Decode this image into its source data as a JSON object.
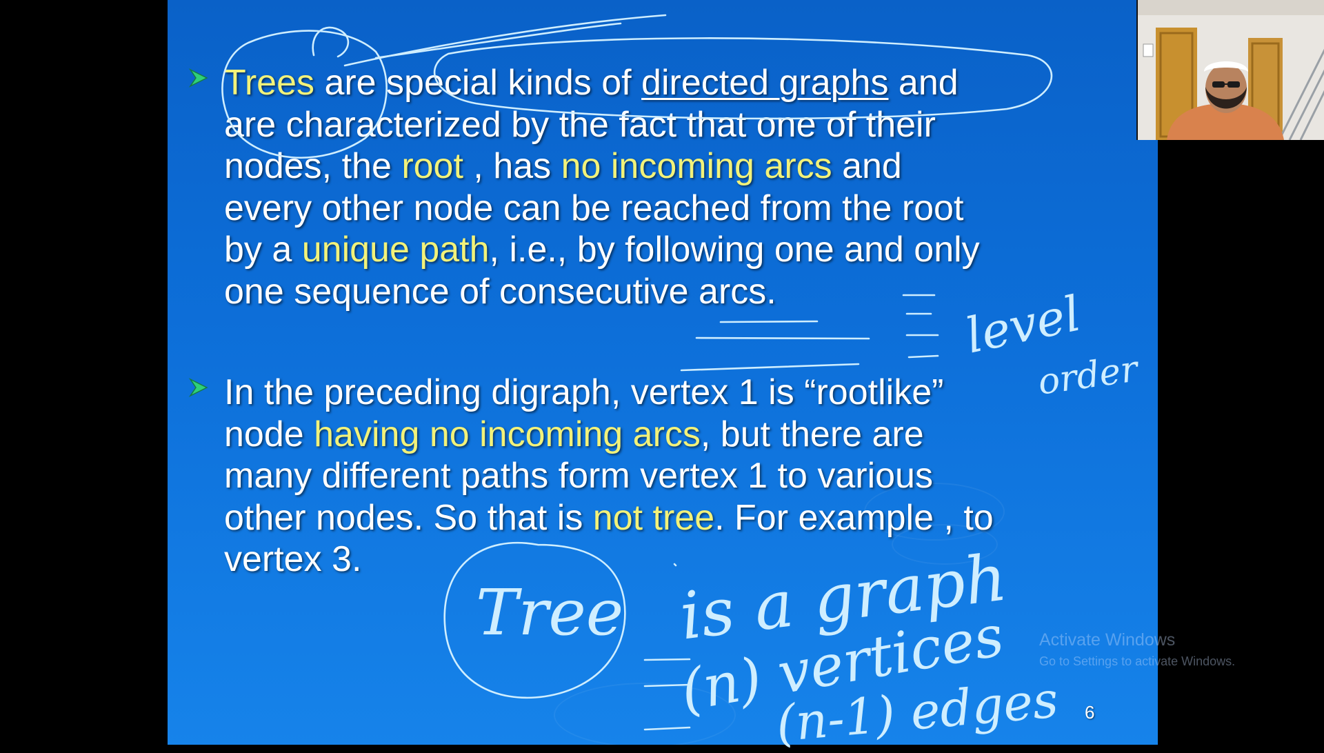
{
  "slide": {
    "page_number": "6",
    "bullets": [
      {
        "lines": [
          [
            {
              "text": "Trees",
              "style": "hl"
            },
            {
              "text": " are special kinds of ",
              "style": ""
            },
            {
              "text": "directed graphs",
              "style": "ul"
            },
            {
              "text": " and",
              "style": ""
            }
          ],
          [
            {
              "text": "are characterized by the fact that one of their",
              "style": ""
            }
          ],
          [
            {
              "text": "nodes, the ",
              "style": ""
            },
            {
              "text": "root",
              "style": "hl"
            },
            {
              "text": " , has ",
              "style": ""
            },
            {
              "text": "no incoming  arcs",
              "style": "hl"
            },
            {
              "text": " and",
              "style": ""
            }
          ],
          [
            {
              "text": "every other node can be reached from the root",
              "style": ""
            }
          ],
          [
            {
              "text": "by a ",
              "style": ""
            },
            {
              "text": "unique path",
              "style": "hl"
            },
            {
              "text": ", i.e., by following one and only",
              "style": ""
            }
          ],
          [
            {
              "text": "one sequence of consecutive arcs.",
              "style": ""
            }
          ]
        ]
      },
      {
        "lines": [
          [
            {
              "text": "In the preceding digraph, vertex 1 is “rootlike”",
              "style": ""
            }
          ],
          [
            {
              "text": "node  ",
              "style": ""
            },
            {
              "text": "having no incoming arcs",
              "style": "hl"
            },
            {
              "text": ", but there are",
              "style": ""
            }
          ],
          [
            {
              "text": "many different paths form vertex 1 to various",
              "style": ""
            }
          ],
          [
            {
              "text": "other nodes. So that is ",
              "style": ""
            },
            {
              "text": "not tree",
              "style": "hl"
            },
            {
              "text": ". For example , to",
              "style": ""
            }
          ],
          [
            {
              "text": "vertex 3.",
              "style": ""
            }
          ]
        ]
      }
    ]
  },
  "handwriting": {
    "note_level": "level",
    "note_order": "order",
    "note_tree": "Tree",
    "note_is_a_graph": "is a graph",
    "note_n_vertices": "(n) vertices",
    "note_n_minus_1_edges": "(n-1) edges"
  },
  "watermark": {
    "title": "Activate Windows",
    "subtitle": "Go to Settings to activate Windows."
  },
  "colors": {
    "slide_background": "#0d6fd9",
    "body_text": "#ffffff",
    "highlight_text": "#f2f27a",
    "bullet_marker": "#2fd07a",
    "ink": "#cfeeff"
  },
  "icons": {
    "bullet_marker": "arrowhead-bullet-icon"
  }
}
